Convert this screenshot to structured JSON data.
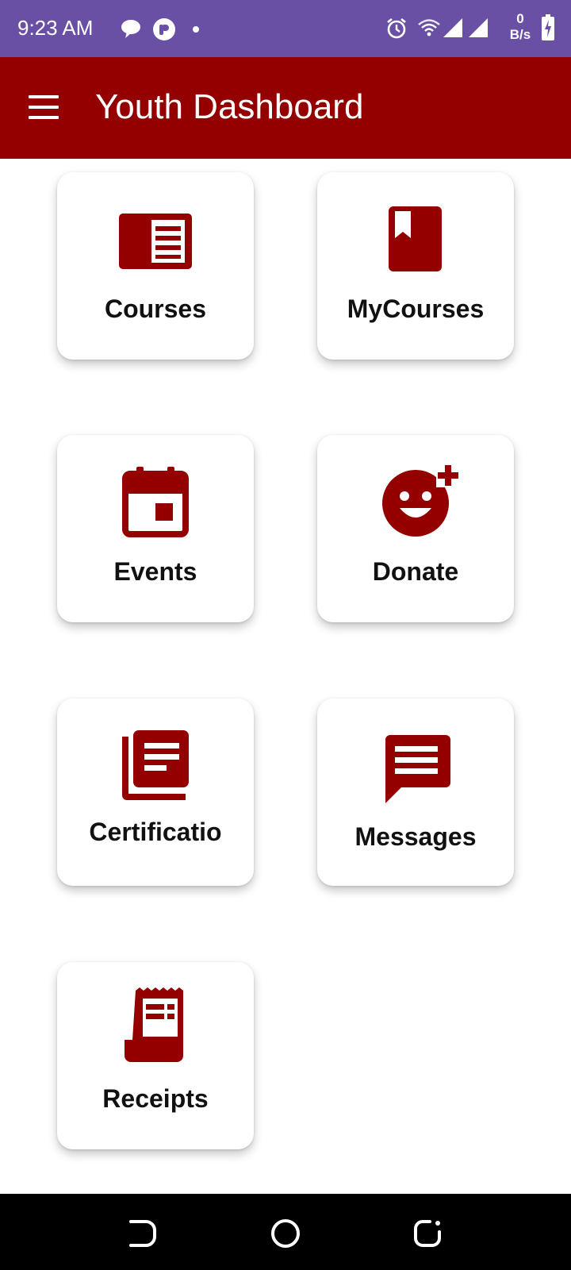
{
  "status_bar": {
    "time": "9:23 AM",
    "net_speed_value": "0",
    "net_speed_unit": "B/s",
    "icons": [
      "chat-bubble-icon",
      "app-notification-icon",
      "dot-icon",
      "alarm-icon",
      "wifi-icon",
      "signal-icon",
      "signal-icon",
      "battery-charging-icon"
    ]
  },
  "app_bar": {
    "title": "Youth Dashboard",
    "menu_icon": "hamburger-menu-icon"
  },
  "tiles": [
    {
      "label": "Courses",
      "icon": "newspaper-icon"
    },
    {
      "label": "MyCourses",
      "icon": "bookmarked-book-icon"
    },
    {
      "label": "Events",
      "icon": "calendar-event-icon"
    },
    {
      "label": "Donate",
      "icon": "smiley-add-icon"
    },
    {
      "label": "Certificatio",
      "icon": "library-books-icon"
    },
    {
      "label": "Messages",
      "icon": "message-icon"
    },
    {
      "label": "Receipts",
      "icon": "receipt-icon"
    }
  ],
  "nav_bar": {
    "buttons": [
      "back-icon",
      "home-icon",
      "recents-icon"
    ]
  },
  "colors": {
    "status_bar": "#6a50a4",
    "app_bar": "#940000",
    "icon": "#940000",
    "nav_bar": "#000000"
  }
}
